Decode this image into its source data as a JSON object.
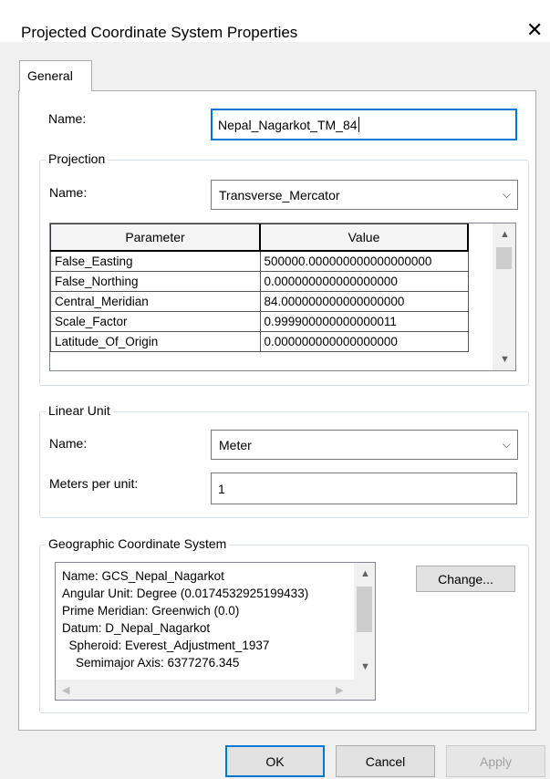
{
  "window": {
    "title": "Projected Coordinate System Properties",
    "close_glyph": "✕"
  },
  "tabs": [
    {
      "label": "General"
    }
  ],
  "general": {
    "name_label": "Name:",
    "name_value": "Nepal_Nagarkot_TM_84"
  },
  "projection": {
    "group_label": "Projection",
    "name_label": "Name:",
    "name_value": "Transverse_Mercator",
    "columns": [
      "Parameter",
      "Value"
    ],
    "rows": [
      [
        "False_Easting",
        "500000.000000000000000000"
      ],
      [
        "False_Northing",
        "0.000000000000000000"
      ],
      [
        "Central_Meridian",
        "84.000000000000000000"
      ],
      [
        "Scale_Factor",
        "0.999900000000000011"
      ],
      [
        "Latitude_Of_Origin",
        "0.000000000000000000"
      ]
    ]
  },
  "linear_unit": {
    "group_label": "Linear Unit",
    "name_label": "Name:",
    "name_value": "Meter",
    "per_unit_label": "Meters per unit:",
    "per_unit_value": "1"
  },
  "gcs": {
    "group_label": "Geographic Coordinate System",
    "lines": [
      "Name: GCS_Nepal_Nagarkot",
      "Angular Unit: Degree (0.0174532925199433)",
      "Prime Meridian: Greenwich (0.0)",
      "Datum: D_Nepal_Nagarkot",
      "  Spheroid: Everest_Adjustment_1937",
      "    Semimajor Axis: 6377276.345"
    ],
    "change_button": "Change..."
  },
  "buttons": {
    "ok": "OK",
    "cancel": "Cancel",
    "apply": "Apply"
  },
  "colors": {
    "focus": "#0078d7",
    "dialog_bg": "#f0f0f0",
    "panel_bg": "#ffffff"
  }
}
